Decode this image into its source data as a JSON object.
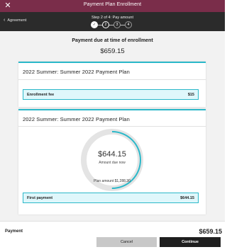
{
  "window": {
    "title": "Payment Plan Enrollment",
    "close_icon": "close-icon"
  },
  "stepbar": {
    "back_label": "Agreement",
    "step_title": "Step 2 of 4: Pay amount",
    "steps": [
      {
        "label": "✓",
        "state": "done"
      },
      {
        "label": "2",
        "state": "current"
      },
      {
        "label": "3",
        "state": "future"
      },
      {
        "label": "4",
        "state": "future"
      }
    ]
  },
  "summary": {
    "due_label": "Payment due at time of enrollment",
    "due_amount": "$659.15"
  },
  "plan1": {
    "title": "2022 Summer: Summer 2022 Payment Plan",
    "fee_label": "Enrollment fee",
    "fee_value": "$15"
  },
  "plan2": {
    "title": "2022 Summer: Summer 2022 Payment Plan",
    "amount_due": "$644.15",
    "amount_due_label": "Amount due now",
    "amount_due_fraction": 0.5,
    "plan_amount": "Plan amount $1,288.30",
    "first_payment_label": "First payment",
    "first_payment_value": "$644.15"
  },
  "footer": {
    "payment_label": "Payment",
    "payment_value": "$659.15",
    "cancel_label": "Cancel",
    "continue_label": "Continue"
  },
  "colors": {
    "header": "#7a2d4a",
    "stepbar": "#2b2b2b",
    "accent": "#2bb8c9",
    "ring_track": "#e4e4e4"
  }
}
